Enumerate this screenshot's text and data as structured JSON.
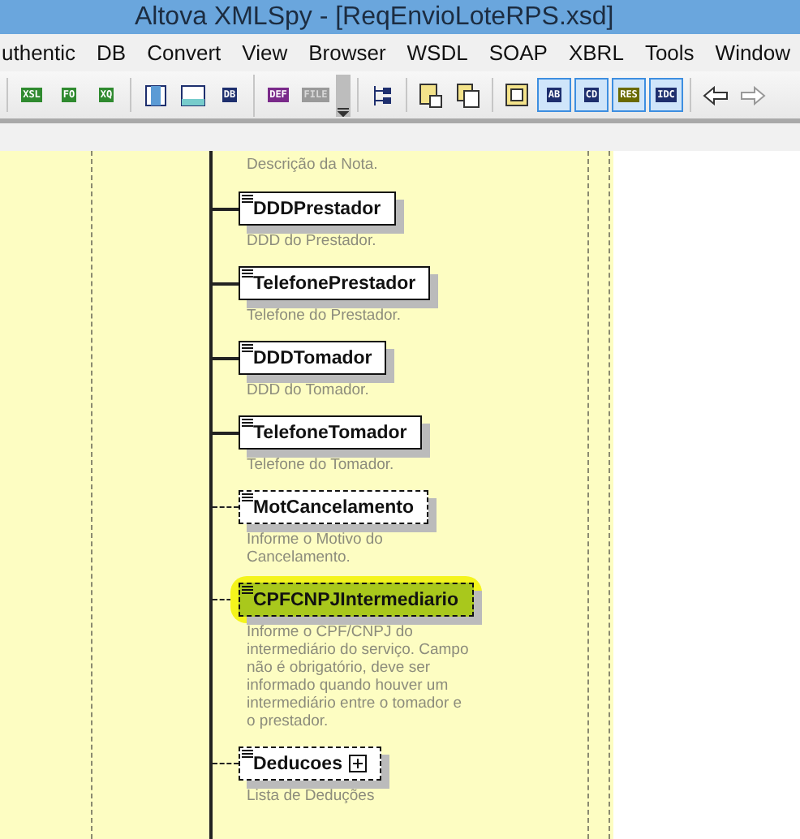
{
  "window": {
    "title": "Altova XMLSpy - [ReqEnvioLoteRPS.xsd]"
  },
  "menu": [
    "uthentic",
    "DB",
    "Convert",
    "View",
    "Browser",
    "WSDL",
    "SOAP",
    "XBRL",
    "Tools",
    "Window"
  ],
  "toolbar": [
    [
      {
        "kind": "tag",
        "label": "XSL",
        "color": "#2f8a2f",
        "disabled": false,
        "selected": false
      },
      {
        "kind": "tag",
        "label": "FO",
        "color": "#2f8a2f",
        "disabled": false,
        "selected": false
      },
      {
        "kind": "tag",
        "label": "XQ",
        "color": "#2f8a2f",
        "disabled": false,
        "selected": false
      }
    ],
    [
      {
        "kind": "split",
        "disabled": false,
        "selected": false
      },
      {
        "kind": "pane",
        "disabled": false,
        "selected": false
      },
      {
        "kind": "tag",
        "label": "DB",
        "color": "#1e2f6e",
        "disabled": false,
        "selected": false
      }
    ],
    [
      {
        "kind": "tag",
        "label": "DEF",
        "color": "#7a2a8a",
        "disabled": false,
        "selected": false
      },
      {
        "kind": "tag",
        "label": "FILE",
        "color": "#9a9a9a",
        "disabled": true,
        "selected": false
      },
      {
        "kind": "overflow"
      }
    ],
    [
      {
        "kind": "tree",
        "disabled": false,
        "selected": false
      }
    ],
    [
      {
        "kind": "copy",
        "disabled": false,
        "selected": false
      },
      {
        "kind": "paste",
        "disabled": false,
        "selected": false
      }
    ],
    [
      {
        "kind": "insert",
        "disabled": false,
        "selected": false
      },
      {
        "kind": "tag",
        "label": "AB",
        "color": "#1e2f6e",
        "disabled": false,
        "selected": true
      },
      {
        "kind": "tag",
        "label": "CD",
        "color": "#1e2f6e",
        "disabled": false,
        "selected": true
      },
      {
        "kind": "tag",
        "label": "RES",
        "color": "#6a6a00",
        "disabled": false,
        "selected": true
      },
      {
        "kind": "tag",
        "label": "IDC",
        "color": "#1e2f6e",
        "disabled": false,
        "selected": true
      }
    ],
    [
      {
        "kind": "back",
        "disabled": false,
        "selected": false
      },
      {
        "kind": "forward",
        "disabled": true,
        "selected": false
      }
    ]
  ],
  "schema": {
    "lead_description": "Descrição da Nota.",
    "elements": [
      {
        "name": "DDDPrestador",
        "description": "DDD do Prestador.",
        "optional": false,
        "highlighted": false,
        "expandable": false
      },
      {
        "name": "TelefonePrestador",
        "description": "Telefone do Prestador.",
        "optional": false,
        "highlighted": false,
        "expandable": false
      },
      {
        "name": "DDDTomador",
        "description": "DDD do Tomador.",
        "optional": false,
        "highlighted": false,
        "expandable": false
      },
      {
        "name": "TelefoneTomador",
        "description": "Telefone do Tomador.",
        "optional": false,
        "highlighted": false,
        "expandable": false
      },
      {
        "name": "MotCancelamento",
        "description": "Informe o Motivo do Cancelamento.",
        "optional": true,
        "highlighted": false,
        "expandable": false
      },
      {
        "name": "CPFCNPJIntermediario",
        "description": "Informe o CPF/CNPJ do intermediário do serviço. Campo não é obrigatório, deve ser informado quando houver um intermediário entre o tomador e o prestador.",
        "optional": true,
        "highlighted": true,
        "expandable": false
      },
      {
        "name": "Deducoes",
        "description": "Lista de Deduções",
        "optional": true,
        "highlighted": false,
        "expandable": true
      }
    ]
  }
}
